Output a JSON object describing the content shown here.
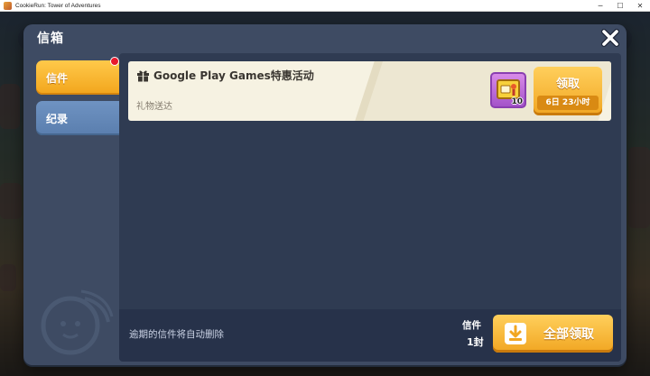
{
  "window": {
    "title": "CookieRun: Tower of Adventures",
    "minimize_glyph": "─",
    "maximize_glyph": "☐",
    "close_glyph": "✕"
  },
  "modal": {
    "title": "信箱",
    "close_icon": "close-x-icon"
  },
  "tabs": [
    {
      "label": "信件",
      "active": true,
      "has_notification": true
    },
    {
      "label": "纪录",
      "active": false
    }
  ],
  "mail_items": [
    {
      "title": "Google Play Games特惠活动",
      "subtitle": "礼物送达",
      "icon": "gift-icon",
      "reward": {
        "icon": "reward-item-icon",
        "count": "10"
      },
      "claim_label": "领取",
      "time_left": "6日 23小时"
    }
  ],
  "footer": {
    "note": "逾期的信件将自动删除",
    "count_label": "信件",
    "count_value": "1封",
    "claim_all_label": "全部领取",
    "claim_all_icon": "download-icon"
  },
  "colors": {
    "modal_bg": "#3e4b63",
    "accent_orange": "#f1a622",
    "tab_blue": "#5a7eae",
    "notification_red": "#e8192c"
  }
}
